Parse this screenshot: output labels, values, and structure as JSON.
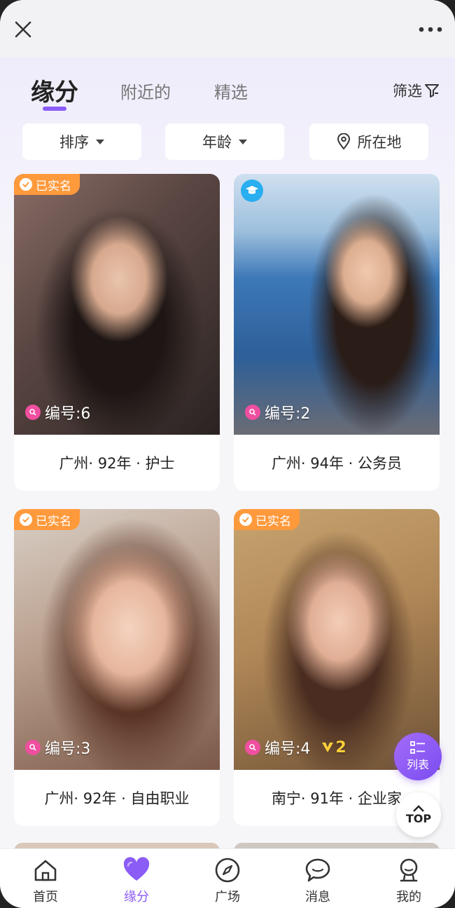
{
  "header": {
    "close_icon": "close-icon",
    "more_icon": "more-icon"
  },
  "tabs": [
    {
      "label": "缘分",
      "active": true
    },
    {
      "label": "附近的",
      "active": false
    },
    {
      "label": "精选",
      "active": false
    }
  ],
  "filter_label": "筛选",
  "chips": {
    "sort": "排序",
    "age": "年龄",
    "location": "所在地"
  },
  "cards": [
    {
      "verified": "已实名",
      "id_label": "编号:6",
      "caption": "广州· 92年 · 护士"
    },
    {
      "verified": "",
      "id_label": "编号:2",
      "caption": "广州· 94年 · 公务员",
      "badge_icon": "graduation-cap-icon"
    },
    {
      "verified": "已实名",
      "id_label": "编号:3",
      "caption": "广州· 92年 · 自由职业"
    },
    {
      "verified": "已实名",
      "id_label": "编号:4",
      "vip": "2",
      "caption": "南宁· 91年 · 企业家"
    }
  ],
  "float_buttons": {
    "list_label": "列表",
    "top_label": "TOP"
  },
  "nav": [
    {
      "label": "首页",
      "icon": "home-icon",
      "active": false
    },
    {
      "label": "缘分",
      "icon": "heart-icon",
      "active": true
    },
    {
      "label": "广场",
      "icon": "compass-icon",
      "active": false
    },
    {
      "label": "消息",
      "icon": "chat-bubble-icon",
      "active": false
    },
    {
      "label": "我的",
      "icon": "profile-icon",
      "active": false
    }
  ],
  "colors": {
    "accent": "#8b5cf6",
    "verified_badge": "#ff9a3c",
    "id_icon": "#f04fa0",
    "grad_badge": "#29aef0"
  }
}
